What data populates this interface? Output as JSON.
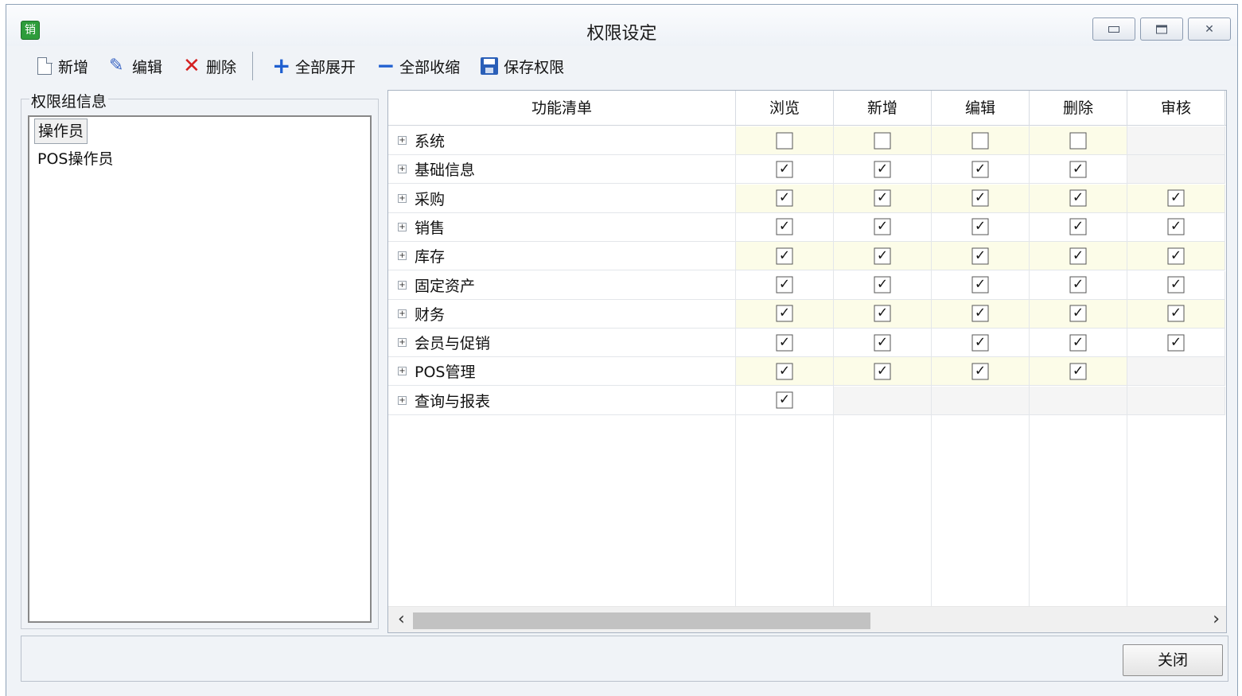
{
  "window": {
    "title": "权限设定",
    "app_icon_text": "销"
  },
  "toolbar": {
    "new_label": "新增",
    "edit_label": "编辑",
    "delete_label": "删除",
    "expand_all_label": "全部展开",
    "collapse_all_label": "全部收缩",
    "save_label": "保存权限"
  },
  "groups": {
    "title": "权限组信息",
    "items": [
      {
        "label": "操作员",
        "selected": true
      },
      {
        "label": "POS操作员",
        "selected": false
      }
    ]
  },
  "grid": {
    "columns": [
      "功能清单",
      "浏览",
      "新增",
      "编辑",
      "删除",
      "审核"
    ],
    "rows": [
      {
        "label": "系统",
        "perms": [
          false,
          false,
          false,
          false,
          null
        ]
      },
      {
        "label": "基础信息",
        "perms": [
          true,
          true,
          true,
          true,
          null
        ]
      },
      {
        "label": "采购",
        "perms": [
          true,
          true,
          true,
          true,
          true
        ]
      },
      {
        "label": "销售",
        "perms": [
          true,
          true,
          true,
          true,
          true
        ]
      },
      {
        "label": "库存",
        "perms": [
          true,
          true,
          true,
          true,
          true
        ]
      },
      {
        "label": "固定资产",
        "perms": [
          true,
          true,
          true,
          true,
          true
        ]
      },
      {
        "label": "财务",
        "perms": [
          true,
          true,
          true,
          true,
          true
        ]
      },
      {
        "label": "会员与促销",
        "perms": [
          true,
          true,
          true,
          true,
          true
        ]
      },
      {
        "label": "POS管理",
        "perms": [
          true,
          true,
          true,
          true,
          null
        ]
      },
      {
        "label": "查询与报表",
        "perms": [
          true,
          null,
          null,
          null,
          null
        ]
      }
    ]
  },
  "footer": {
    "close_label": "关闭"
  },
  "colors": {
    "alt_row": "#fcfce8",
    "disabled_cell": "#f5f5f5"
  }
}
